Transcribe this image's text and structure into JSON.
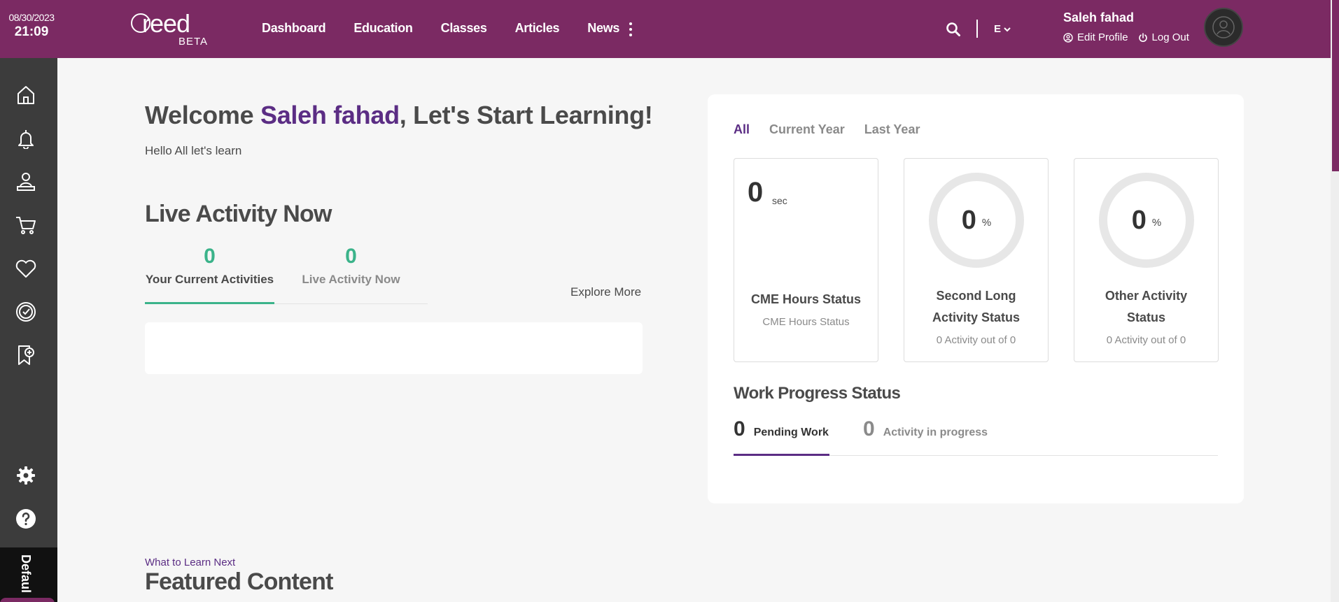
{
  "header": {
    "date": "08/30/2023",
    "time": "21:09",
    "logo_text": "reed",
    "logo_badge": "BETA",
    "nav": [
      {
        "label": "Dashboard"
      },
      {
        "label": "Education"
      },
      {
        "label": "Classes"
      },
      {
        "label": "Articles"
      },
      {
        "label": "News"
      }
    ],
    "more_icon": "vertical-dots-icon",
    "search_icon": "search-icon",
    "language": "E",
    "user": {
      "name": "Saleh fahad",
      "edit_profile": "Edit Profile",
      "logout": "Log Out"
    },
    "brand_color": "#7b2a63"
  },
  "sidebar": {
    "items": [
      {
        "icon": "home-icon"
      },
      {
        "icon": "bell-icon"
      },
      {
        "icon": "learner-icon"
      },
      {
        "icon": "cart-icon"
      },
      {
        "icon": "heart-icon"
      },
      {
        "icon": "badge-check-icon"
      },
      {
        "icon": "bookmark-add-icon"
      }
    ],
    "bottom_items": [
      {
        "icon": "gear-icon"
      },
      {
        "icon": "help-icon"
      }
    ],
    "tab_label": "Defaul"
  },
  "main": {
    "welcome_prefix": "Welcome ",
    "welcome_name": "Saleh fahad",
    "welcome_suffix": ", Let's Start Learning!",
    "subtitle": "Hello All let's learn",
    "live_title": "Live Activity Now",
    "activity_tabs": [
      {
        "count": "0",
        "label": "Your Current Activities"
      },
      {
        "count": "0",
        "label": "Live Activity Now"
      }
    ],
    "explore_more": "Explore More",
    "what_next": "What to Learn Next",
    "featured_title": "Featured Content"
  },
  "panel": {
    "period_tabs": [
      "All",
      "Current Year",
      "Last Year"
    ],
    "cards": {
      "cme": {
        "value": "0",
        "unit": "sec",
        "title": "CME Hours Status",
        "sub": "CME Hours Status"
      },
      "second": {
        "value": "0",
        "unit": "%",
        "title_line1": "Second Long",
        "title_line2": "Activity Status",
        "sub": "0 Activity out of 0"
      },
      "other": {
        "value": "0",
        "unit": "%",
        "title_line1": "Other Activity",
        "title_line2": "Status",
        "sub": "0 Activity out of 0"
      }
    },
    "work_progress_title": "Work Progress Status",
    "work_tabs": [
      {
        "count": "0",
        "label": "Pending Work"
      },
      {
        "count": "0",
        "label": "Activity in progress"
      }
    ]
  }
}
